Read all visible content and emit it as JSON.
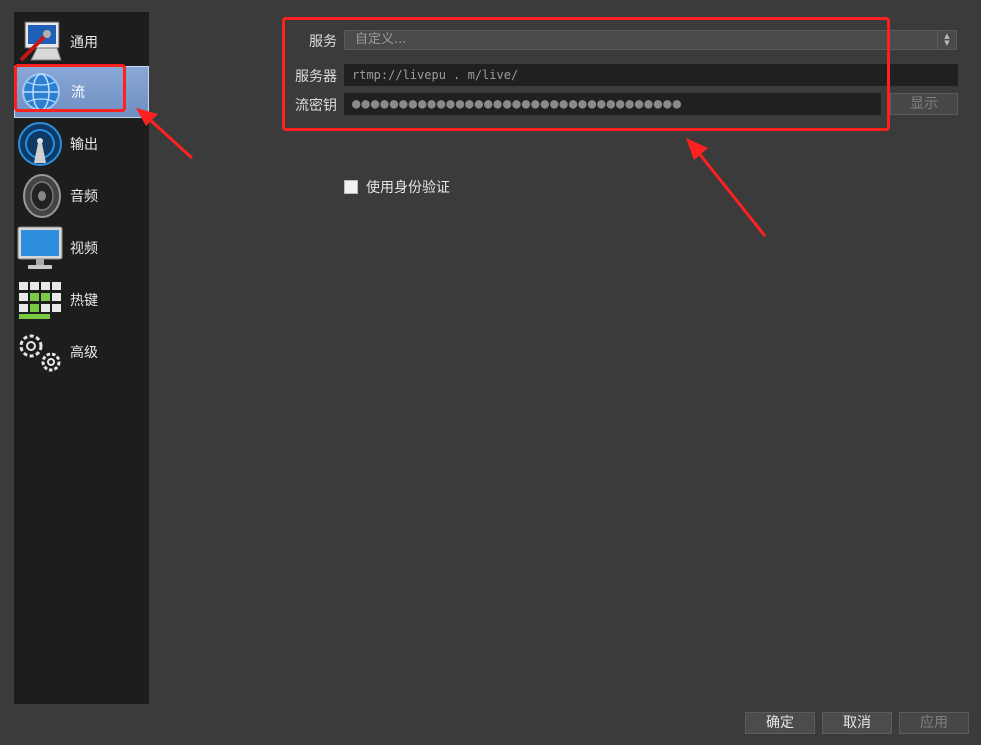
{
  "sidebar": {
    "items": [
      {
        "label": "通用",
        "icon": "general-settings-icon"
      },
      {
        "label": "流",
        "icon": "stream-globe-icon",
        "selected": true
      },
      {
        "label": "输出",
        "icon": "output-antenna-icon"
      },
      {
        "label": "音频",
        "icon": "audio-speaker-icon"
      },
      {
        "label": "视频",
        "icon": "video-monitor-icon"
      },
      {
        "label": "热键",
        "icon": "hotkeys-keyboard-icon"
      },
      {
        "label": "高级",
        "icon": "advanced-gears-icon"
      }
    ]
  },
  "stream": {
    "service_label": "服务",
    "service_value": "自定义...",
    "server_label": "服务器",
    "server_value": "rtmp://livepu  .          m/live/",
    "key_label": "流密钥",
    "key_value": "●●●●●●●●●●●●●●●●●●●●●●●●●●●●●●●●●●●",
    "show_button": "显示",
    "auth_checkbox_label": "使用身份验证",
    "auth_checked": false
  },
  "footer": {
    "ok": "确定",
    "cancel": "取消",
    "apply": "应用"
  },
  "colors": {
    "background": "#3b3b3b",
    "sidebar": "#1d1d1d",
    "selected": "#7f9ccd",
    "annotation": "#ff2020"
  }
}
